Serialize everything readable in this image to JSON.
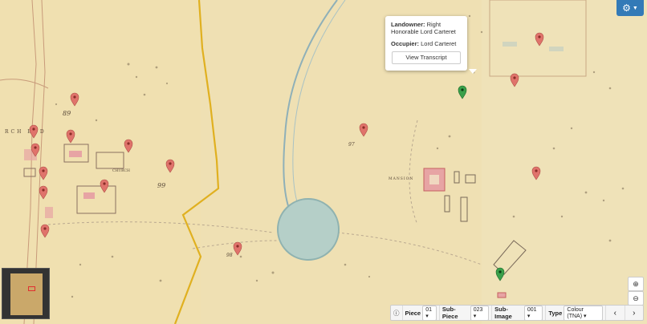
{
  "map": {
    "hamlet_label": "RCH END",
    "church_label": "CHURCH",
    "mansion_label": "MANSION",
    "parcel_labels": [
      "89",
      "99",
      "97",
      "98"
    ]
  },
  "popup": {
    "landowner_label": "Landowner:",
    "landowner_value": "Right Honorable Lord Carteret",
    "occupier_label": "Occupier:",
    "occupier_value": "Lord Carteret",
    "button_label": "View Transcript"
  },
  "controls": {
    "settings_icon": "gear-icon",
    "zoom_in": "+",
    "zoom_out": "−"
  },
  "toolbar": {
    "piece_label": "Piece",
    "piece_value": "01",
    "subpiece_label": "Sub-Piece",
    "subpiece_value": "023",
    "subimage_label": "Sub-Image",
    "subimage_value": "001",
    "type_label": "Type",
    "type_value": "Colour (TNA)",
    "prev": "‹",
    "next": "›"
  },
  "colors": {
    "accent": "#337ab7",
    "marker_red": "#e0736b",
    "marker_green": "#3aa04a",
    "map_paper": "#efe0b3"
  }
}
